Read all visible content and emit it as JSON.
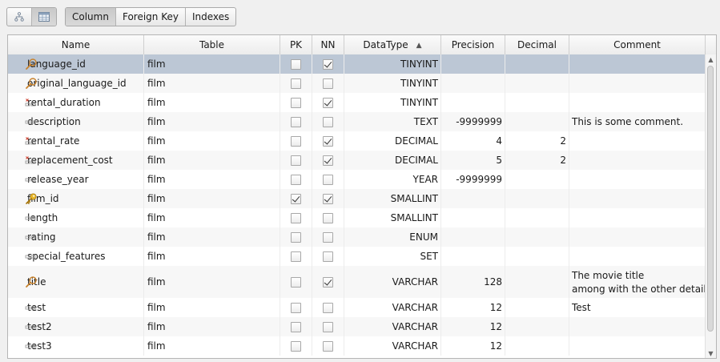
{
  "toolbar": {
    "view_icons": [
      {
        "name": "diagram-view-icon"
      },
      {
        "name": "grid-view-icon",
        "selected": true
      }
    ],
    "tabs": [
      {
        "label": "Column",
        "selected": true
      },
      {
        "label": "Foreign Key",
        "selected": false
      },
      {
        "label": "Indexes",
        "selected": false
      }
    ]
  },
  "columns": {
    "name": "Name",
    "table": "Table",
    "pk": "PK",
    "nn": "NN",
    "datatype": "DataType",
    "precision": "Precision",
    "decimal": "Decimal",
    "comment": "Comment",
    "sort_column": "datatype",
    "sort_direction": "ascending"
  },
  "rows": [
    {
      "icon": "index-search-icon",
      "name": "language_id",
      "table": "film",
      "pk": false,
      "nn": true,
      "datatype": "TINYINT",
      "precision": "",
      "decimal": "",
      "comment": [],
      "selected": true
    },
    {
      "icon": "index-search-icon",
      "name": "original_language_id",
      "table": "film",
      "pk": false,
      "nn": false,
      "datatype": "TINYINT",
      "precision": "",
      "decimal": "",
      "comment": []
    },
    {
      "icon": "not-null-column-icon",
      "name": "rental_duration",
      "table": "film",
      "pk": false,
      "nn": true,
      "datatype": "TINYINT",
      "precision": "",
      "decimal": "",
      "comment": []
    },
    {
      "icon": "column-icon",
      "name": "description",
      "table": "film",
      "pk": false,
      "nn": false,
      "datatype": "TEXT",
      "precision": "-9999999",
      "decimal": "",
      "comment": [
        "This is some comment."
      ]
    },
    {
      "icon": "not-null-column-icon",
      "name": "rental_rate",
      "table": "film",
      "pk": false,
      "nn": true,
      "datatype": "DECIMAL",
      "precision": "4",
      "decimal": "2",
      "comment": []
    },
    {
      "icon": "not-null-column-icon",
      "name": "replacement_cost",
      "table": "film",
      "pk": false,
      "nn": true,
      "datatype": "DECIMAL",
      "precision": "5",
      "decimal": "2",
      "comment": []
    },
    {
      "icon": "column-icon",
      "name": "release_year",
      "table": "film",
      "pk": false,
      "nn": false,
      "datatype": "YEAR",
      "precision": "-9999999",
      "decimal": "",
      "comment": []
    },
    {
      "icon": "primary-key-icon",
      "name": "film_id",
      "table": "film",
      "pk": true,
      "nn": true,
      "datatype": "SMALLINT",
      "precision": "",
      "decimal": "",
      "comment": []
    },
    {
      "icon": "column-icon",
      "name": "length",
      "table": "film",
      "pk": false,
      "nn": false,
      "datatype": "SMALLINT",
      "precision": "",
      "decimal": "",
      "comment": []
    },
    {
      "icon": "column-icon",
      "name": "rating",
      "table": "film",
      "pk": false,
      "nn": false,
      "datatype": "ENUM",
      "precision": "",
      "decimal": "",
      "comment": []
    },
    {
      "icon": "column-icon",
      "name": "special_features",
      "table": "film",
      "pk": false,
      "nn": false,
      "datatype": "SET",
      "precision": "",
      "decimal": "",
      "comment": []
    },
    {
      "icon": "index-search-icon",
      "name": "title",
      "table": "film",
      "pk": false,
      "nn": true,
      "datatype": "VARCHAR",
      "precision": "128",
      "decimal": "",
      "comment": [
        "The movie title",
        "among with the other details"
      ]
    },
    {
      "icon": "column-icon",
      "name": "test",
      "table": "film",
      "pk": false,
      "nn": false,
      "datatype": "VARCHAR",
      "precision": "12",
      "decimal": "",
      "comment": [
        "Test"
      ]
    },
    {
      "icon": "column-icon",
      "name": "test2",
      "table": "film",
      "pk": false,
      "nn": false,
      "datatype": "VARCHAR",
      "precision": "12",
      "decimal": "",
      "comment": []
    },
    {
      "icon": "column-icon",
      "name": "test3",
      "table": "film",
      "pk": false,
      "nn": false,
      "datatype": "VARCHAR",
      "precision": "12",
      "decimal": "",
      "comment": []
    }
  ],
  "colors": {
    "selected_row": "#bcc7d5",
    "key_icon": "#d9a416",
    "search_icon": "#c8822c"
  }
}
